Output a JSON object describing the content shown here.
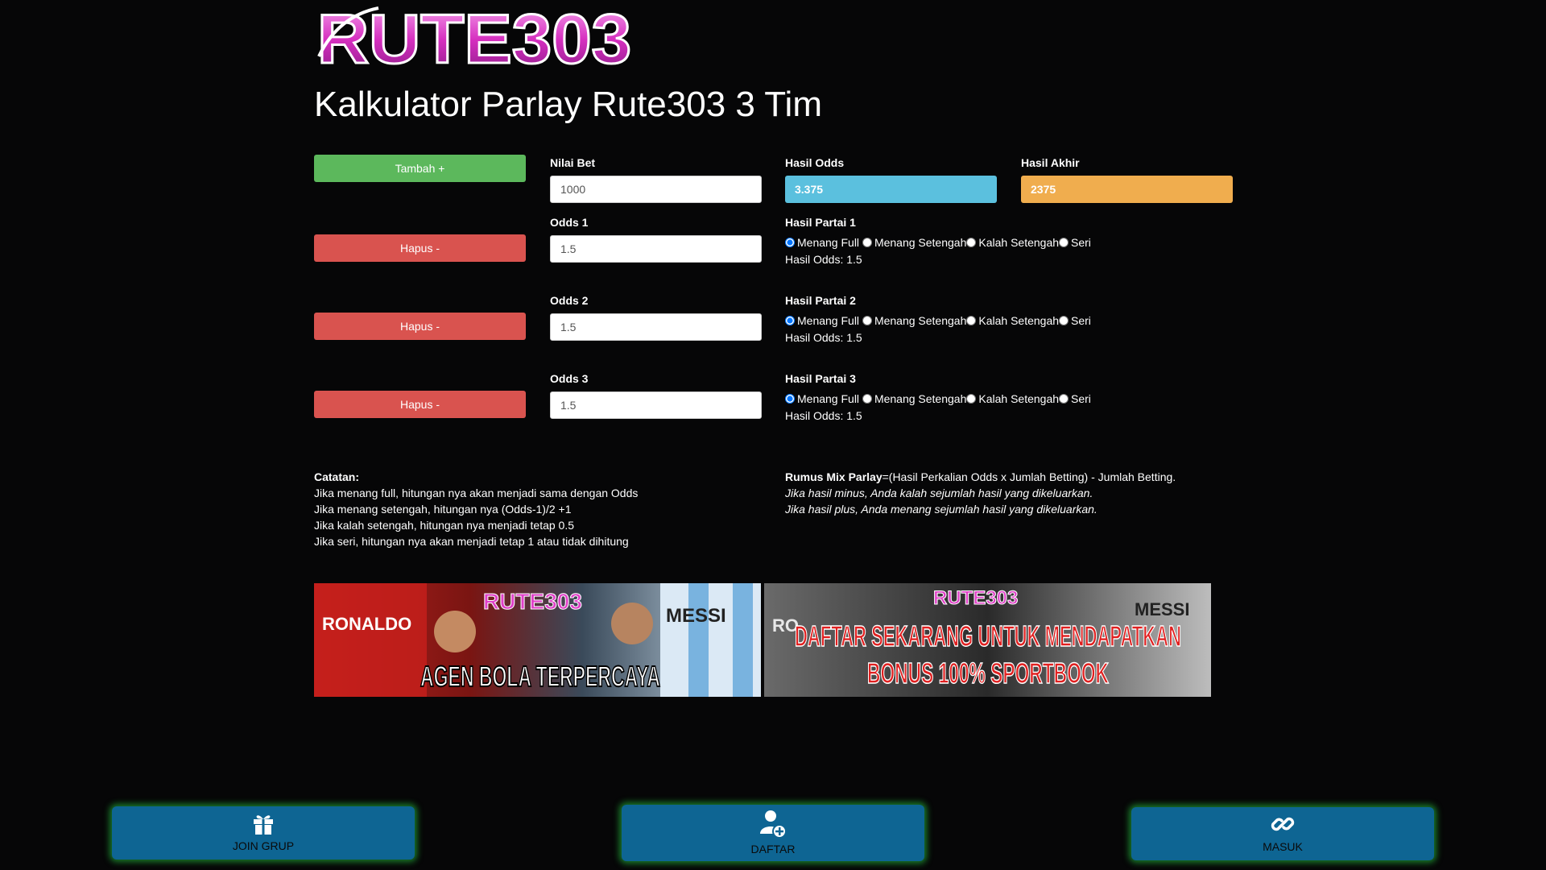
{
  "brand": {
    "logo_text": "RUTE303"
  },
  "page": {
    "title": "Kalkulator Parlay Rute303 3 Tim"
  },
  "calculator": {
    "add_label": "Tambah +",
    "delete_label": "Hapus -",
    "bet": {
      "label": "Nilai Bet",
      "value": "1000"
    },
    "hasil_odds": {
      "label": "Hasil Odds",
      "value": "3.375"
    },
    "hasil_akhir": {
      "label": "Hasil Akhir",
      "value": "2375"
    },
    "options": [
      "Menang Full",
      "Menang Setengah",
      "Kalah Setengah",
      "Seri"
    ],
    "rows": [
      {
        "odds_label": "Odds 1",
        "odds_value": "1.5",
        "result_label": "Hasil Partai 1",
        "selected": "Menang Full",
        "result_text": "Hasil Odds: 1.5"
      },
      {
        "odds_label": "Odds 2",
        "odds_value": "1.5",
        "result_label": "Hasil Partai 2",
        "selected": "Menang Full",
        "result_text": "Hasil Odds: 1.5"
      },
      {
        "odds_label": "Odds 3",
        "odds_value": "1.5",
        "result_label": "Hasil Partai 3",
        "selected": "Menang Full",
        "result_text": "Hasil Odds: 1.5"
      }
    ]
  },
  "notes": {
    "heading": "Catatan:",
    "lines": [
      "Jika menang full, hitungan nya akan menjadi sama dengan Odds",
      "Jika menang setengah, hitungan nya (Odds-1)/2 +1",
      "Jika kalah setengah, hitungan nya menjadi tetap 0.5",
      "Jika seri, hitungan nya akan menjadi tetap 1 atau tidak dihitung"
    ]
  },
  "formula": {
    "heading": "Rumus Mix Parlay",
    "text": "=(Hasil Perkalian Odds x Jumlah Betting) - Jumlah Betting.",
    "minus": "Jika hasil minus, Anda kalah sejumlah hasil yang dikeluarkan.",
    "plus": "Jika hasil plus, Anda menang sejumlah hasil yang dikeluarkan."
  },
  "banners": [
    {
      "brand": "RUTE303",
      "jersey_left": "RONALDO",
      "jersey_right": "MESSI",
      "caption": "AGEN BOLA TERPERCAYA"
    },
    {
      "brand": "RUTE303",
      "jersey_left": "RO",
      "jersey_right": "MESSI",
      "caption_line1": "DAFTAR SEKARANG UNTUK MENDAPATKAN",
      "caption_line2": "BONUS 100% SPORTBOOK"
    }
  ],
  "bottom_nav": [
    {
      "label": "JOIN GRUP",
      "icon": "gift-icon"
    },
    {
      "label": "DAFTAR",
      "icon": "user-add-icon"
    },
    {
      "label": "MASUK",
      "icon": "link-icon"
    }
  ],
  "colors": {
    "background": "#060607",
    "add_button": "#5cb85c",
    "delete_button": "#d9534f",
    "hasil_odds": "#5bc0de",
    "hasil_akhir": "#f0ad4e",
    "bottom_button": "#0e6593",
    "logo_pink": "#e040c8"
  }
}
